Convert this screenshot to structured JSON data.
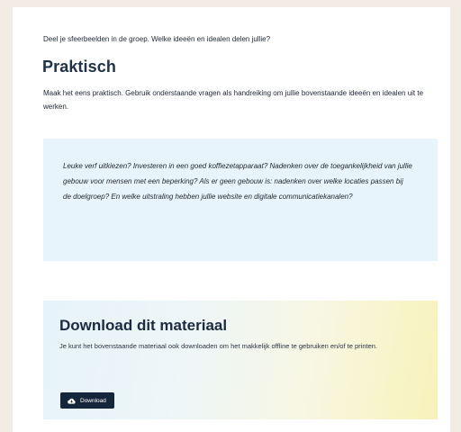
{
  "intro_text": "Deel je sfeerbeelden in de groep. Welke ideeën en idealen delen jullie?",
  "section": {
    "title": "Praktisch",
    "paragraph": "Maak het eens praktisch. Gebruik onderstaande vragen als handreiking om jullie bovenstaande ideeën en idealen uit te werken."
  },
  "quote": {
    "text": "Leuke verf uitkiezen? Investeren in een goed koffiezetapparaat? Nadenken over de toegankelijkheid van jullie gebouw voor mensen met een beperking? Als er geen gebouw is: nadenken over welke locaties passen bij de doelgroep? En welke uitstraling hebben jullie website en digitale communicatiekanalen?"
  },
  "download": {
    "title": "Download dit materiaal",
    "description": "Je kunt het bovenstaande materiaal ook downloaden om het makkelijk offline te gebruiken en/of te printen.",
    "button_label": "Download",
    "button_icon": "cloud-download-icon"
  },
  "colors": {
    "page_background": "#f3ece4",
    "heading": "#203148",
    "quote_background": "#e8f4fb",
    "button_background": "#16263a",
    "gradient_start": "#e6f3fa",
    "gradient_end": "#f8f2b9"
  }
}
